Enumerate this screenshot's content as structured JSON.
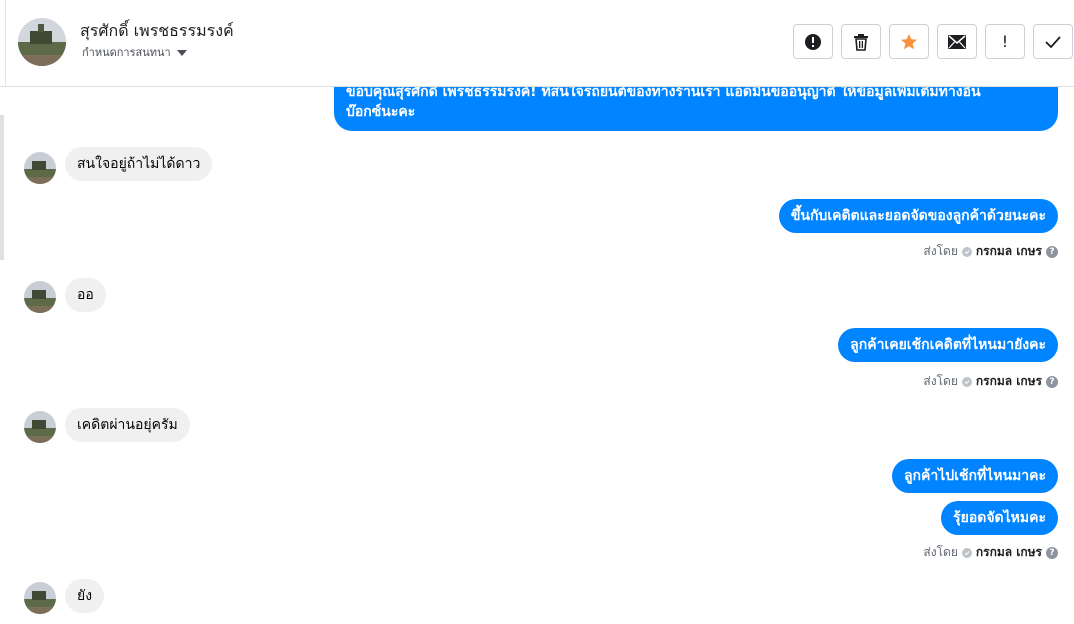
{
  "header": {
    "contact_name": "สุรศักดิ์ เพรชธรรมรงค์",
    "assign_label": "กำหนดการสนทนา"
  },
  "toolbar": {
    "buttons": [
      {
        "name": "spam-report",
        "icon": "alert-circle-icon"
      },
      {
        "name": "delete",
        "icon": "trash-icon"
      },
      {
        "name": "star",
        "icon": "star-icon",
        "color": "#f7923a"
      },
      {
        "name": "mark-unread",
        "icon": "envelope-icon"
      },
      {
        "name": "follow-up",
        "icon": "exclamation-icon",
        "label": "!"
      },
      {
        "name": "mark-done",
        "icon": "check-icon"
      }
    ]
  },
  "messages": {
    "m1": {
      "direction": "out",
      "text_line1": "ขอบคุณสุรศักดิ์ เพรชธรรมรงค์! ที่สนใจรถยนต์ของทางร้านเรา แอดมินขออนุญาติ ให้ข้อมูลเพิ่มเติมทางอิน",
      "text_line2": "บ๊อกซ์นะคะ"
    },
    "m2": {
      "direction": "in",
      "text": "สนใจอยู่ถ้าไม่ได้ดาว"
    },
    "m3": {
      "direction": "out",
      "text": "ขึ้นกับเคดิตและยอดจัดของลูกค้าด้วยนะคะ"
    },
    "m4": {
      "direction": "in",
      "text": "ออ"
    },
    "m5": {
      "direction": "out",
      "text": "ลูกค้าเคยเช้กเคดิตที่ไหนมายังคะ"
    },
    "m6": {
      "direction": "in",
      "text": "เคดิตผ่านอยุ่ครัม"
    },
    "m7": {
      "direction": "out",
      "text": "ลูกค้าไปเช้กที่ไหนมาคะ"
    },
    "m8": {
      "direction": "out",
      "text": "รุ้ยอดจัดไหมคะ"
    },
    "m9": {
      "direction": "in",
      "text": "ยัง"
    }
  },
  "sent_by": {
    "prefix": "ส่งโดย",
    "agent": "กรกมล เกษร",
    "help": "?"
  },
  "colors": {
    "outgoing_bubble": "#0084ff",
    "incoming_bubble": "#f0f0f0"
  }
}
